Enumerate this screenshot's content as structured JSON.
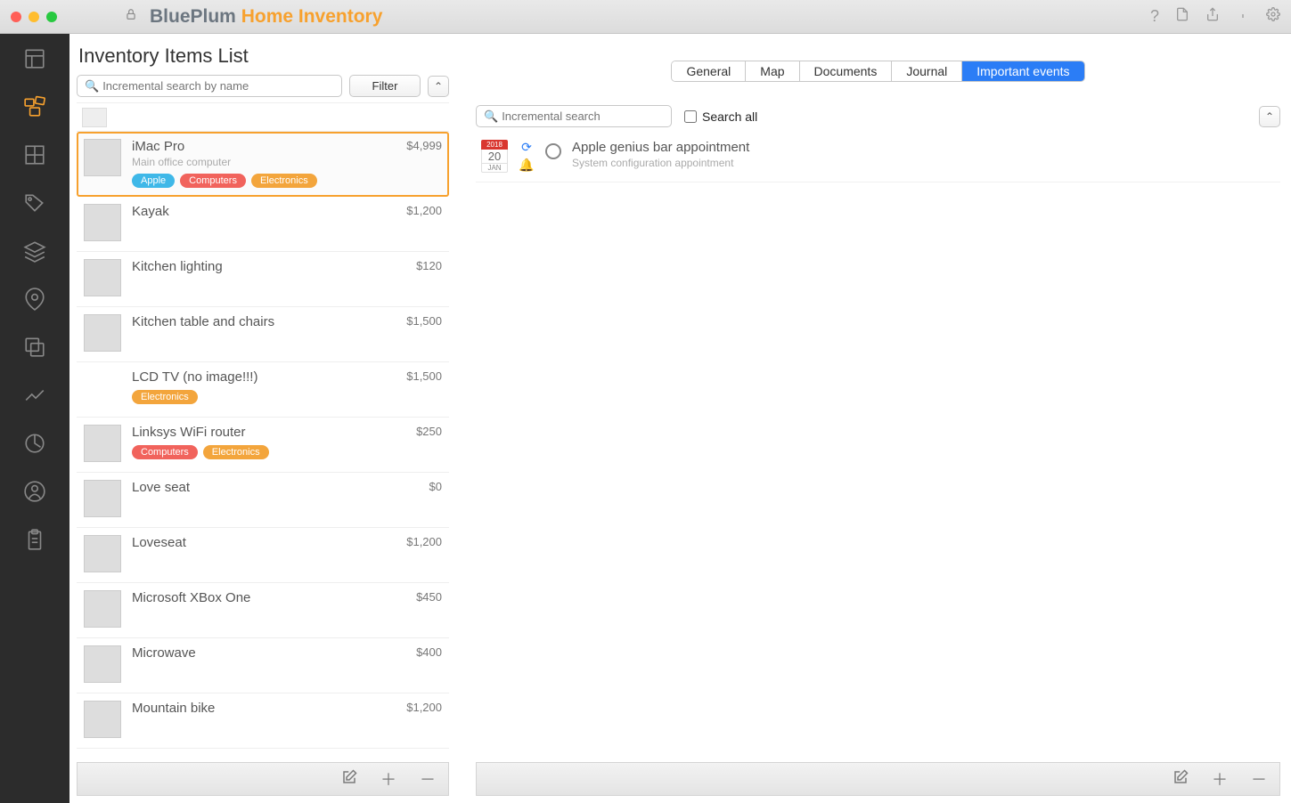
{
  "app": {
    "title1": "BluePlum",
    "title2": "Home Inventory"
  },
  "tag_colors": {
    "Apple": "#3fb8e8",
    "Computers": "#f1635c",
    "Electronics": "#f3a53c"
  },
  "left": {
    "heading": "Inventory Items List",
    "search_placeholder": "Incremental search by name",
    "filter_label": "Filter",
    "items": [
      {
        "name": "iMac Pro",
        "subtitle": "Main office computer",
        "price": "$4,999",
        "tags": [
          "Apple",
          "Computers",
          "Electronics"
        ],
        "selected": true
      },
      {
        "name": "Kayak",
        "price": "$1,200",
        "tags": []
      },
      {
        "name": "Kitchen lighting",
        "price": "$120",
        "tags": []
      },
      {
        "name": "Kitchen table and chairs",
        "price": "$1,500",
        "tags": []
      },
      {
        "name": "LCD TV (no image!!!)",
        "price": "$1,500",
        "tags": [
          "Electronics"
        ],
        "noimage": true
      },
      {
        "name": "Linksys WiFi router",
        "price": "$250",
        "tags": [
          "Computers",
          "Electronics"
        ]
      },
      {
        "name": "Love seat",
        "price": "$0",
        "tags": []
      },
      {
        "name": "Loveseat",
        "price": "$1,200",
        "tags": []
      },
      {
        "name": "Microsoft XBox One",
        "price": "$450",
        "tags": []
      },
      {
        "name": "Microwave",
        "price": "$400",
        "tags": []
      },
      {
        "name": "Mountain bike",
        "price": "$1,200",
        "tags": []
      }
    ]
  },
  "right": {
    "tabs": [
      "General",
      "Map",
      "Documents",
      "Journal",
      "Important events"
    ],
    "active_tab": 4,
    "search_placeholder": "Incremental search",
    "search_all_label": "Search all",
    "events": [
      {
        "year": "2018",
        "day": "20",
        "month": "JAN",
        "title": "Apple genius bar appointment",
        "subtitle": "System configuration appointment"
      }
    ]
  }
}
